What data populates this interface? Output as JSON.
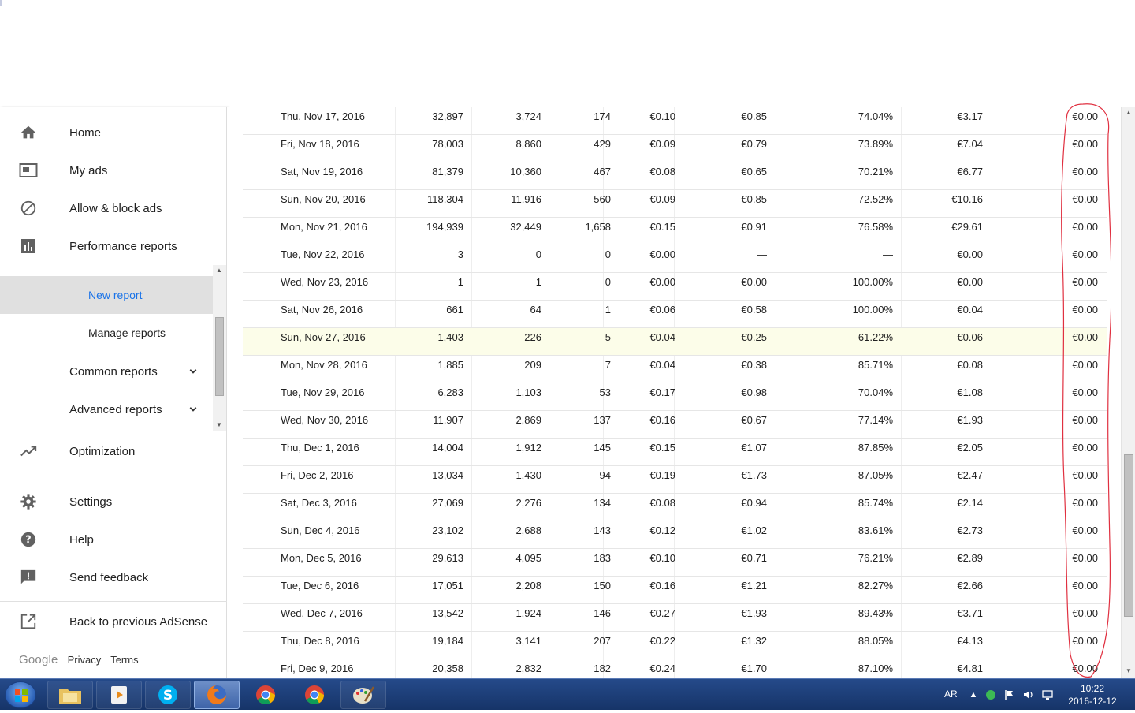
{
  "sidebar": {
    "items": [
      {
        "label": "Home",
        "icon": "home-icon"
      },
      {
        "label": "My ads",
        "icon": "my-ads-icon"
      },
      {
        "label": "Allow & block ads",
        "icon": "block-icon"
      },
      {
        "label": "Performance reports",
        "icon": "bar-chart-icon"
      }
    ],
    "sub_items": [
      {
        "label": "New report",
        "active": true
      },
      {
        "label": "Manage reports",
        "active": false
      }
    ],
    "groups": [
      {
        "label": "Common reports"
      },
      {
        "label": "Advanced reports"
      }
    ],
    "optimization": "Optimization",
    "lower_items": [
      {
        "label": "Settings",
        "icon": "gear-icon"
      },
      {
        "label": "Help",
        "icon": "help-icon"
      },
      {
        "label": "Send feedback",
        "icon": "feedback-icon"
      }
    ],
    "back": "Back to previous AdSense",
    "footer": {
      "brand": "Google",
      "privacy": "Privacy",
      "terms": "Terms"
    }
  },
  "table": {
    "rows": [
      [
        "Thu, Nov 17, 2016",
        "32,897",
        "3,724",
        "174",
        "€0.10",
        "€0.85",
        "74.04%",
        "€3.17",
        "€0.00"
      ],
      [
        "Fri, Nov 18, 2016",
        "78,003",
        "8,860",
        "429",
        "€0.09",
        "€0.79",
        "73.89%",
        "€7.04",
        "€0.00"
      ],
      [
        "Sat, Nov 19, 2016",
        "81,379",
        "10,360",
        "467",
        "€0.08",
        "€0.65",
        "70.21%",
        "€6.77",
        "€0.00"
      ],
      [
        "Sun, Nov 20, 2016",
        "118,304",
        "11,916",
        "560",
        "€0.09",
        "€0.85",
        "72.52%",
        "€10.16",
        "€0.00"
      ],
      [
        "Mon, Nov 21, 2016",
        "194,939",
        "32,449",
        "1,658",
        "€0.15",
        "€0.91",
        "76.58%",
        "€29.61",
        "€0.00"
      ],
      [
        "Tue, Nov 22, 2016",
        "3",
        "0",
        "0",
        "€0.00",
        "—",
        "—",
        "€0.00",
        "€0.00"
      ],
      [
        "Wed, Nov 23, 2016",
        "1",
        "1",
        "0",
        "€0.00",
        "€0.00",
        "100.00%",
        "€0.00",
        "€0.00"
      ],
      [
        "Sat, Nov 26, 2016",
        "661",
        "64",
        "1",
        "€0.06",
        "€0.58",
        "100.00%",
        "€0.04",
        "€0.00"
      ],
      [
        "Sun, Nov 27, 2016",
        "1,403",
        "226",
        "5",
        "€0.04",
        "€0.25",
        "61.22%",
        "€0.06",
        "€0.00"
      ],
      [
        "Mon, Nov 28, 2016",
        "1,885",
        "209",
        "7",
        "€0.04",
        "€0.38",
        "85.71%",
        "€0.08",
        "€0.00"
      ],
      [
        "Tue, Nov 29, 2016",
        "6,283",
        "1,103",
        "53",
        "€0.17",
        "€0.98",
        "70.04%",
        "€1.08",
        "€0.00"
      ],
      [
        "Wed, Nov 30, 2016",
        "11,907",
        "2,869",
        "137",
        "€0.16",
        "€0.67",
        "77.14%",
        "€1.93",
        "€0.00"
      ],
      [
        "Thu, Dec 1, 2016",
        "14,004",
        "1,912",
        "145",
        "€0.15",
        "€1.07",
        "87.85%",
        "€2.05",
        "€0.00"
      ],
      [
        "Fri, Dec 2, 2016",
        "13,034",
        "1,430",
        "94",
        "€0.19",
        "€1.73",
        "87.05%",
        "€2.47",
        "€0.00"
      ],
      [
        "Sat, Dec 3, 2016",
        "27,069",
        "2,276",
        "134",
        "€0.08",
        "€0.94",
        "85.74%",
        "€2.14",
        "€0.00"
      ],
      [
        "Sun, Dec 4, 2016",
        "23,102",
        "2,688",
        "143",
        "€0.12",
        "€1.02",
        "83.61%",
        "€2.73",
        "€0.00"
      ],
      [
        "Mon, Dec 5, 2016",
        "29,613",
        "4,095",
        "183",
        "€0.10",
        "€0.71",
        "76.21%",
        "€2.89",
        "€0.00"
      ],
      [
        "Tue, Dec 6, 2016",
        "17,051",
        "2,208",
        "150",
        "€0.16",
        "€1.21",
        "82.27%",
        "€2.66",
        "€0.00"
      ],
      [
        "Wed, Dec 7, 2016",
        "13,542",
        "1,924",
        "146",
        "€0.27",
        "€1.93",
        "89.43%",
        "€3.71",
        "€0.00"
      ],
      [
        "Thu, Dec 8, 2016",
        "19,184",
        "3,141",
        "207",
        "€0.22",
        "€1.32",
        "88.05%",
        "€4.13",
        "€0.00"
      ],
      [
        "Fri, Dec 9, 2016",
        "20,358",
        "2,832",
        "182",
        "€0.24",
        "€1.70",
        "87.10%",
        "€4.81",
        "€0.00"
      ]
    ],
    "highlighted_row": 8,
    "annotation_color": "#e03040"
  },
  "taskbar": {
    "apps": [
      "file-explorer-icon",
      "media-player-icon",
      "skype-icon",
      "firefox-icon",
      "chrome-icon",
      "chrome-icon",
      "paint-icon"
    ],
    "active_app": 3,
    "lang": "AR",
    "time": "10:22",
    "date": "2016-12-12"
  }
}
